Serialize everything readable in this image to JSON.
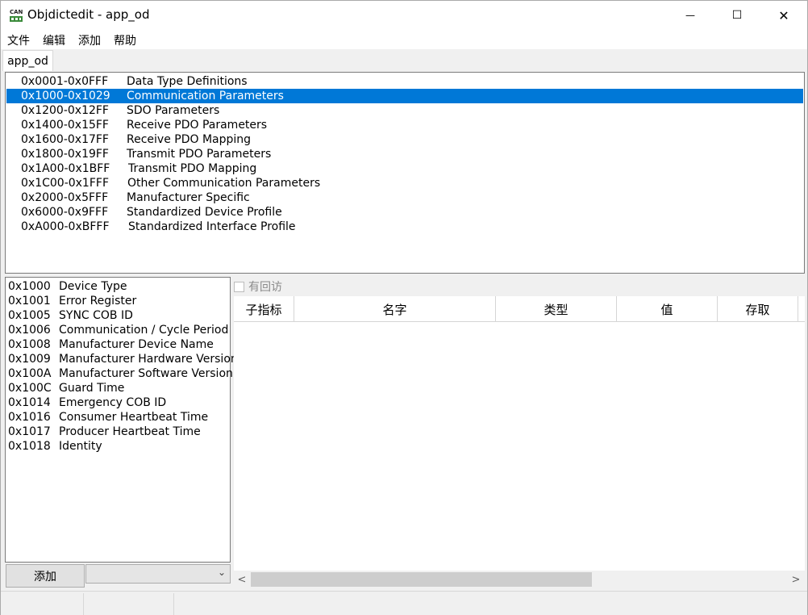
{
  "window": {
    "title": "Objdictedit - app_od",
    "icon": "can-logo-icon",
    "minimize_glyph": "—",
    "maximize_glyph": "☐",
    "close_glyph": "✕"
  },
  "menu": [
    "文件",
    "编辑",
    "添加",
    "帮助"
  ],
  "tabs": [
    {
      "label": "app_od",
      "active": true
    }
  ],
  "ranges": [
    {
      "code": "0x0001-0x0FFF",
      "name": "Data Type Definitions"
    },
    {
      "code": "0x1000-0x1029",
      "name": "Communication Parameters",
      "selected": true
    },
    {
      "code": "0x1200-0x12FF",
      "name": "SDO Parameters"
    },
    {
      "code": "0x1400-0x15FF",
      "name": "Receive PDO Parameters"
    },
    {
      "code": "0x1600-0x17FF",
      "name": "Receive PDO Mapping"
    },
    {
      "code": "0x1800-0x19FF",
      "name": "Transmit PDO Parameters"
    },
    {
      "code": "0x1A00-0x1BFF",
      "name": "Transmit PDO Mapping"
    },
    {
      "code": "0x1C00-0x1FFF",
      "name": "Other Communication Parameters"
    },
    {
      "code": "0x2000-0x5FFF",
      "name": "Manufacturer Specific"
    },
    {
      "code": "0x6000-0x9FFF",
      "name": "Standardized Device Profile"
    },
    {
      "code": "0xA000-0xBFFF",
      "name": "Standardized Interface Profile"
    }
  ],
  "indexes": [
    {
      "code": "0x1000",
      "name": "Device Type"
    },
    {
      "code": "0x1001",
      "name": "Error Register"
    },
    {
      "code": "0x1005",
      "name": "SYNC COB ID"
    },
    {
      "code": "0x1006",
      "name": "Communication / Cycle Period"
    },
    {
      "code": "0x1008",
      "name": "Manufacturer Device Name"
    },
    {
      "code": "0x1009",
      "name": "Manufacturer Hardware Version"
    },
    {
      "code": "0x100A",
      "name": "Manufacturer Software Version"
    },
    {
      "code": "0x100C",
      "name": "Guard Time"
    },
    {
      "code": "0x1014",
      "name": "Emergency COB ID"
    },
    {
      "code": "0x1016",
      "name": "Consumer Heartbeat Time"
    },
    {
      "code": "0x1017",
      "name": "Producer Heartbeat Time"
    },
    {
      "code": "0x1018",
      "name": "Identity"
    }
  ],
  "add_button_label": "添加",
  "add_combo_value": "",
  "callback_checkbox": {
    "label": "有回访",
    "checked": false,
    "enabled": false
  },
  "grid_columns": [
    "子指标",
    "名字",
    "类型",
    "值",
    "存取"
  ],
  "scroll": {
    "left_arrow": "<",
    "right_arrow": ">"
  },
  "status_panes": [
    "",
    "",
    ""
  ]
}
